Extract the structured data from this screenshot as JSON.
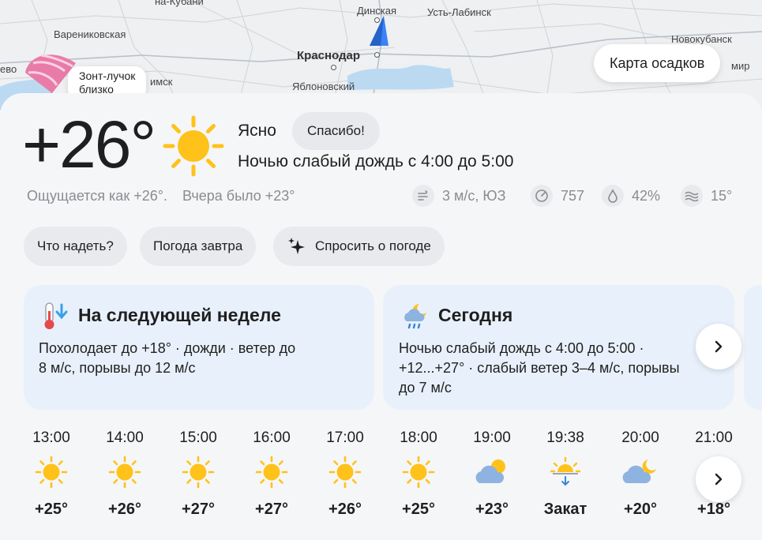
{
  "map": {
    "labels": {
      "na_kubani": "на-Кубани",
      "dinskaya": "Динская",
      "ust_labinsk": "Усть-Лабинск",
      "varenikovskaya": "Варениковская",
      "novokubansk": "Новокубанск",
      "krasnodar": "Краснодар",
      "evo": "ево",
      "imsk": "имск",
      "yablonovsky": "Яблоновский",
      "mir": "мир"
    },
    "precip_button": "Карта осадков",
    "umbrella_hint": "Зонт-лучок\nблизко"
  },
  "current": {
    "temperature": "+26°",
    "condition": "Ясно",
    "thanks_button": "Спасибо!",
    "rain_note": "Ночью слабый дождь с 4:00 до 5:00",
    "feels_like": "Ощущается как +26°.",
    "yesterday": "Вчера было +23°",
    "wind": "3 м/с, ЮЗ",
    "pressure": "757",
    "humidity": "42%",
    "water": "15°"
  },
  "chips": {
    "what_to_wear": "Что надеть?",
    "tomorrow": "Погода завтра",
    "ask": "Спросить о погоде"
  },
  "cards": {
    "week": {
      "title": "На следующей неделе",
      "line1": "Похолодает до +18° · дожди · ветер до",
      "line2": "8 м/с, порывы до 12 м/с"
    },
    "today": {
      "title": "Сегодня",
      "line1": "Ночью слабый дождь с 4:00 до 5:00 ·",
      "line2": "+12...+27° · слабый ветер 3–4 м/с, порывы",
      "line3": "до 7 м/с"
    }
  },
  "hourly": [
    {
      "time": "13:00",
      "icon": "sun-icon",
      "value": "+25°"
    },
    {
      "time": "14:00",
      "icon": "sun-icon",
      "value": "+26°"
    },
    {
      "time": "15:00",
      "icon": "sun-icon",
      "value": "+27°"
    },
    {
      "time": "16:00",
      "icon": "sun-icon",
      "value": "+27°"
    },
    {
      "time": "17:00",
      "icon": "sun-icon",
      "value": "+26°"
    },
    {
      "time": "18:00",
      "icon": "sun-icon",
      "value": "+25°"
    },
    {
      "time": "19:00",
      "icon": "partly-cloudy-icon",
      "value": "+23°"
    },
    {
      "time": "19:38",
      "icon": "sunset-icon",
      "value": "Закат"
    },
    {
      "time": "20:00",
      "icon": "cloudy-night-icon",
      "value": "+20°"
    },
    {
      "time": "21:00",
      "icon": "clear-night-icon",
      "value": "+18°"
    }
  ],
  "colors": {
    "sun": "#FFC21A",
    "card_bg": "#F5F6F8",
    "info_card_bg": "#E8F1FB",
    "chip_bg": "#E9EAED",
    "muted_text": "#8A8C90",
    "text": "#1F1F1F"
  }
}
